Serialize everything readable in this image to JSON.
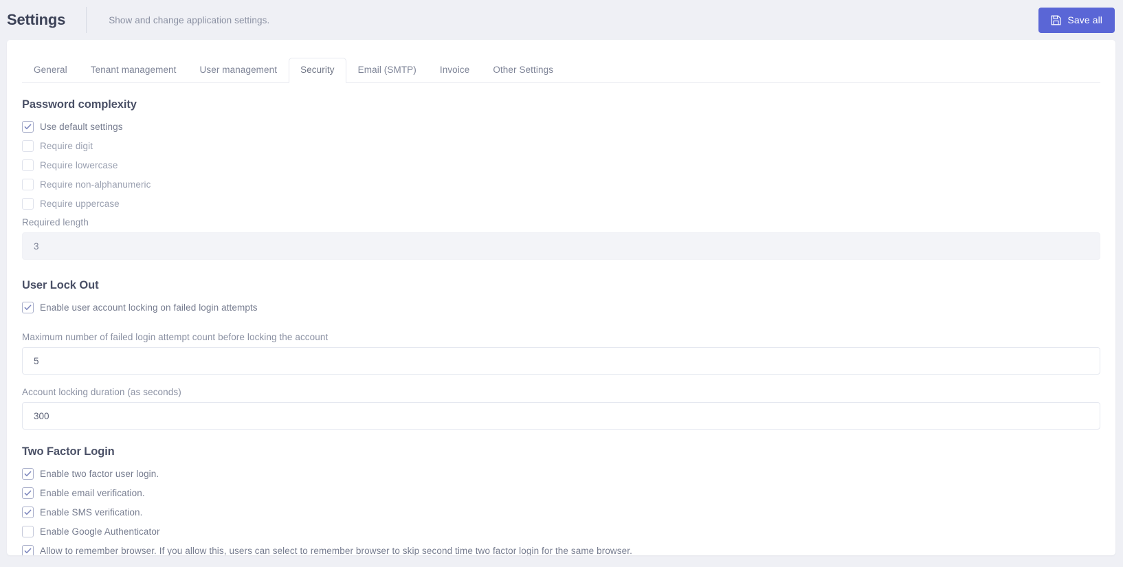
{
  "header": {
    "title": "Settings",
    "subtitle": "Show and change application settings.",
    "save_label": "Save all",
    "save_icon": "floppy-disk-save-icon",
    "accent_color": "#5a66d6"
  },
  "tabs": [
    {
      "label": "General",
      "active": false
    },
    {
      "label": "Tenant management",
      "active": false
    },
    {
      "label": "User management",
      "active": false
    },
    {
      "label": "Security",
      "active": true
    },
    {
      "label": "Email (SMTP)",
      "active": false
    },
    {
      "label": "Invoice",
      "active": false
    },
    {
      "label": "Other Settings",
      "active": false
    }
  ],
  "sections": {
    "password_complexity": {
      "title": "Password complexity",
      "checkboxes": [
        {
          "label": "Use default settings",
          "checked": true,
          "disabled": false
        },
        {
          "label": "Require digit",
          "checked": false,
          "disabled": true
        },
        {
          "label": "Require lowercase",
          "checked": false,
          "disabled": true
        },
        {
          "label": "Require non-alphanumeric",
          "checked": false,
          "disabled": true
        },
        {
          "label": "Require uppercase",
          "checked": false,
          "disabled": true
        }
      ],
      "required_length": {
        "label": "Required length",
        "value": "3",
        "disabled": true
      }
    },
    "user_lock_out": {
      "title": "User Lock Out",
      "enable_checkbox": {
        "label": "Enable user account locking on failed login attempts",
        "checked": true
      },
      "max_failed_attempts": {
        "label": "Maximum number of failed login attempt count before locking the account",
        "value": "5"
      },
      "lock_duration": {
        "label": "Account locking duration (as seconds)",
        "value": "300"
      }
    },
    "two_factor_login": {
      "title": "Two Factor Login",
      "checkboxes": [
        {
          "label": "Enable two factor user login.",
          "checked": true
        },
        {
          "label": "Enable email verification.",
          "checked": true
        },
        {
          "label": "Enable SMS verification.",
          "checked": true
        },
        {
          "label": "Enable Google Authenticator",
          "checked": false
        },
        {
          "label": "Allow to remember browser. If you allow this, users can select to remember browser to skip second time two factor login for the same browser.",
          "checked": true
        }
      ]
    }
  }
}
